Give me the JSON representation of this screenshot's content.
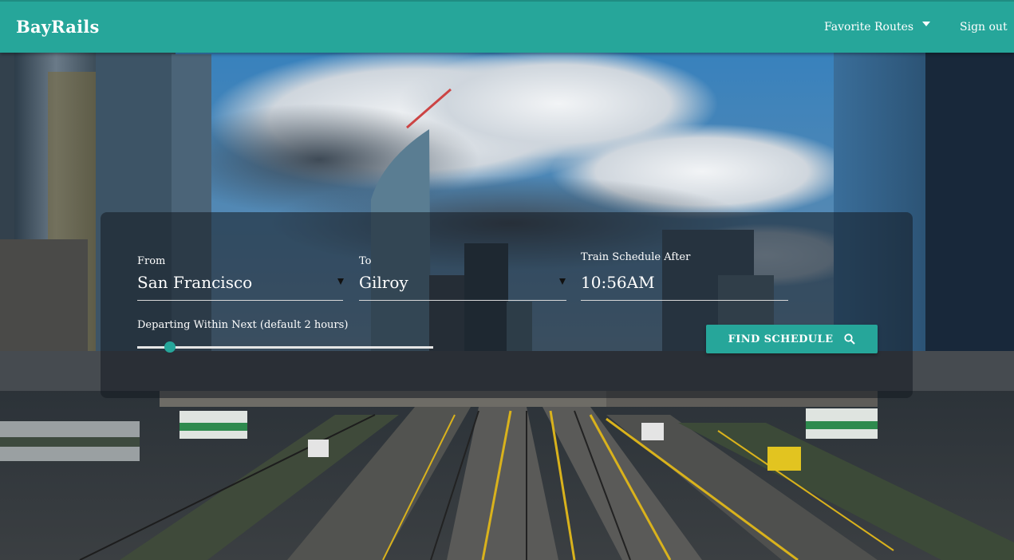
{
  "navbar": {
    "brand": "BayRails",
    "favorite_routes": "Favorite Routes",
    "sign_out": "Sign out",
    "color": "#26a69a"
  },
  "search": {
    "from": {
      "label": "From",
      "value": "San Francisco"
    },
    "to": {
      "label": "To",
      "value": "Gilroy"
    },
    "time": {
      "label": "Train Schedule After",
      "value": "10:56AM"
    },
    "range": {
      "label": "Departing Within Next (default 2 hours)",
      "level": 0.11
    },
    "button": {
      "label": "FIND SCHEDULE",
      "icon": "search-icon"
    }
  }
}
